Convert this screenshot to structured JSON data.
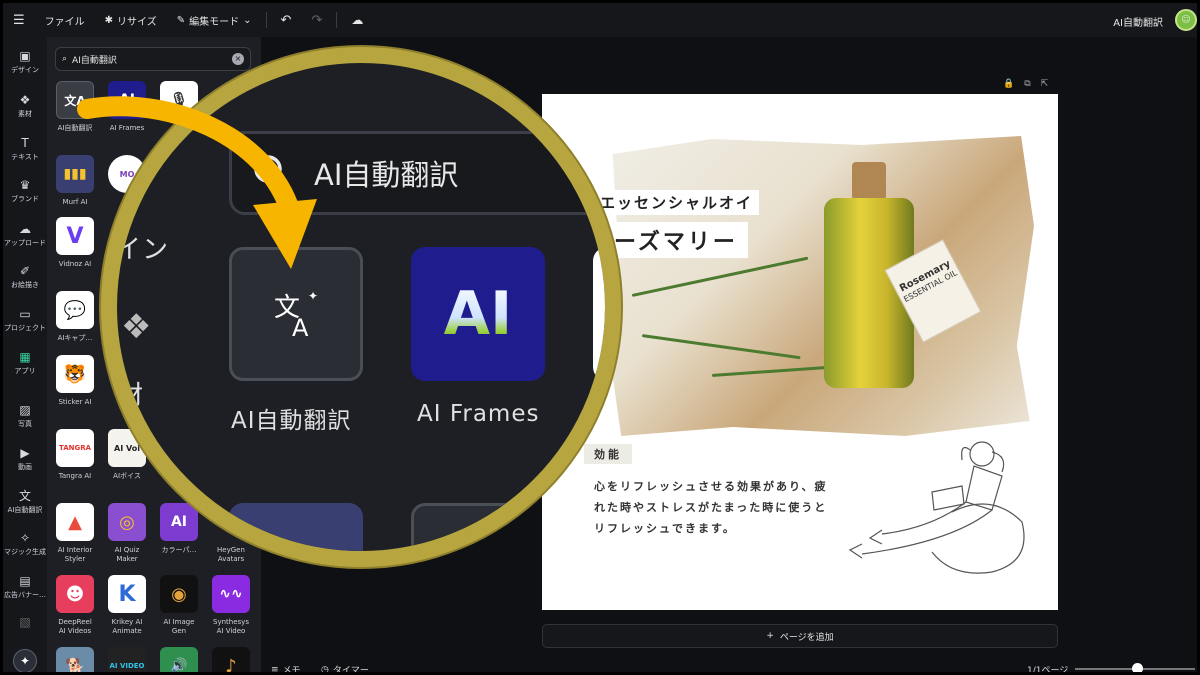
{
  "topbar": {
    "file": "ファイル",
    "resize": "リサイズ",
    "edit_mode": "編集モード",
    "doc_title": "AI自動翻訳"
  },
  "rail": [
    {
      "label": "デザイン",
      "icon": "layout-icon"
    },
    {
      "label": "素材",
      "icon": "elements-icon"
    },
    {
      "label": "テキスト",
      "icon": "text-icon"
    },
    {
      "label": "ブランド",
      "icon": "brand-icon"
    },
    {
      "label": "アップロード",
      "icon": "upload-icon"
    },
    {
      "label": "お絵描き",
      "icon": "draw-icon"
    },
    {
      "label": "プロジェクト",
      "icon": "folder-icon"
    },
    {
      "label": "アプリ",
      "icon": "apps-icon"
    },
    {
      "label": "写真",
      "icon": "photo-icon"
    },
    {
      "label": "動画",
      "icon": "video-icon"
    },
    {
      "label": "AI自動翻訳",
      "icon": "translate-icon"
    },
    {
      "label": "マジック生成",
      "icon": "magic-media-icon"
    },
    {
      "label": "広告バナー…",
      "icon": "banner-icon"
    }
  ],
  "search": {
    "value": "AI自動翻訳"
  },
  "apps": {
    "ai_translate": "AI自動翻訳",
    "ai_frames": "AI Frames",
    "murf": "Murf AI",
    "vidnoz": "Vidnoz AI",
    "ai_caption": "AIキャプ…",
    "sticker": "Sticker AI",
    "tangra": "Tangra AI",
    "ai_voice": "AIボイス",
    "interior_1": "AI Interior",
    "interior_2": "Styler",
    "quiz_1": "AI Quiz",
    "quiz_2": "Maker",
    "color": "カラーパ…",
    "heygen_1": "HeyGen",
    "heygen_2": "Avatars",
    "deepreel_1": "DeepReel",
    "deepreel_2": "AI Videos",
    "krikey_1": "Krikey AI",
    "krikey_2": "Animate",
    "imagegen_1": "AI Image",
    "imagegen_2": "Gen",
    "synthesys_1": "Synthesys",
    "synthesys_2": "AI Video",
    "tangra_tile": "TANGRA",
    "ai_voice_tile": "AI Voi",
    "ai_video_tile": "AI VIDEO",
    "ai_tile": "AI"
  },
  "lens": {
    "search_value": "AI自動翻訳",
    "partial_1": "イン",
    "partial_2": "材",
    "tile1_label": "AI自動翻訳",
    "tile2_label": "AI Frames",
    "ai_tile": "AI"
  },
  "page": {
    "subtitle": "エッセンシャルオイ",
    "title": "ーズマリー",
    "tag_1": "Rosemary",
    "tag_2": "ESSENTIAL OIL",
    "section": "効能",
    "body": "心をリフレッシュさせる効果があり、疲れた時やストレスがたまった時に使うとリフレッシュできます。"
  },
  "add_page": "ページを追加",
  "footer": {
    "memo": "メモ",
    "timer": "タイマー",
    "page_count": "1/1ページ",
    "zoom_fraction": 0.48
  },
  "colors": {
    "accent_green": "#3ad29f",
    "lens_gold": "#b7a53f",
    "arrow_yellow": "#f7b500"
  }
}
